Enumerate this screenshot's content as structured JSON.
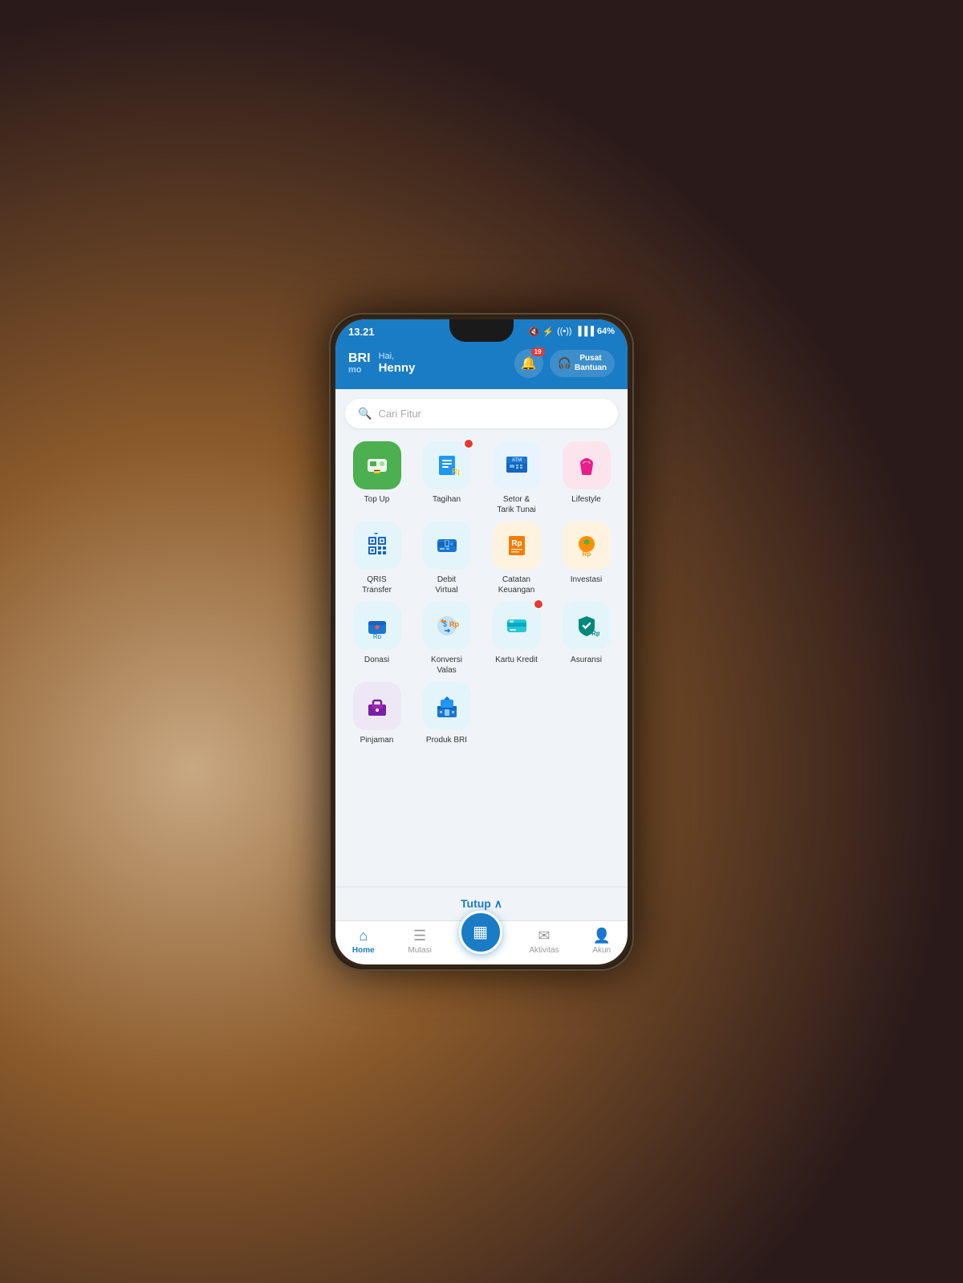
{
  "background": "#2a1a1a",
  "status_bar": {
    "time": "13.21",
    "icons": [
      "♥",
      "◎",
      "▶",
      "•"
    ],
    "right_icons": [
      "🔇",
      "⚡",
      "((•))",
      "▐▐▐▐"
    ],
    "battery": "64%"
  },
  "header": {
    "brand_top": "BRI",
    "brand_bottom": "mo",
    "greeting_pre": "Hai,",
    "greeting_name": "Henny",
    "notification_count": "19",
    "help_label": "Pusat\nBantuan"
  },
  "search": {
    "placeholder": "Cari Fitur"
  },
  "features": [
    {
      "id": "top-up",
      "label": "Top Up",
      "bg": "bg-green",
      "icon": "💳",
      "has_dot": false
    },
    {
      "id": "tagihan",
      "label": "Tagihan",
      "bg": "bg-lightblue",
      "icon": "🧾",
      "has_dot": true
    },
    {
      "id": "setor-tarik",
      "label": "Setor &\nTarik Tunai",
      "bg": "bg-atm",
      "icon": "🏧",
      "has_dot": false
    },
    {
      "id": "lifestyle",
      "label": "Lifestyle",
      "bg": "bg-pink-light",
      "icon": "👜",
      "has_dot": false
    },
    {
      "id": "qris-transfer",
      "label": "QRIS\nTransfer",
      "bg": "bg-qris",
      "icon": "⬛",
      "has_dot": false
    },
    {
      "id": "debit-virtual",
      "label": "Debit\nVirtual",
      "bg": "bg-debit",
      "icon": "💳",
      "has_dot": false
    },
    {
      "id": "catatan-keuangan",
      "label": "Catatan\nKeuangan",
      "bg": "bg-catatan",
      "icon": "📝",
      "has_dot": false
    },
    {
      "id": "investasi",
      "label": "Investasi",
      "bg": "bg-investasi",
      "icon": "🌱",
      "has_dot": false
    },
    {
      "id": "donasi",
      "label": "Donasi",
      "bg": "bg-donasi",
      "icon": "❤️",
      "has_dot": false
    },
    {
      "id": "konversi-valas",
      "label": "Konversi\nValas",
      "bg": "bg-konversi",
      "icon": "💱",
      "has_dot": false
    },
    {
      "id": "kartu-kredit",
      "label": "Kartu Kredit",
      "bg": "bg-kartu",
      "icon": "💳",
      "has_dot": true
    },
    {
      "id": "asuransi",
      "label": "Asuransi",
      "bg": "bg-asuransi",
      "icon": "🛡️",
      "has_dot": false
    },
    {
      "id": "pinjaman",
      "label": "Pinjaman",
      "bg": "bg-pinjaman",
      "icon": "💼",
      "has_dot": false
    },
    {
      "id": "produk-bri",
      "label": "Produk BRI",
      "bg": "bg-produk",
      "icon": "🏦",
      "has_dot": false
    }
  ],
  "tutup": {
    "label": "Tutup",
    "icon": "∧"
  },
  "bottom_nav": [
    {
      "id": "home",
      "label": "Home",
      "icon": "⌂",
      "active": true
    },
    {
      "id": "mutasi",
      "label": "Mutasi",
      "icon": "≡",
      "active": false
    },
    {
      "id": "qris",
      "label": "",
      "icon": "▦",
      "active": false,
      "is_center": true
    },
    {
      "id": "aktivitas",
      "label": "Aktivitas",
      "icon": "✉",
      "active": false
    },
    {
      "id": "akun",
      "label": "Akun",
      "icon": "👤",
      "active": false
    }
  ],
  "colors": {
    "brand_blue": "#1a7cc4",
    "red_dot": "#e53935",
    "text_dark": "#333333",
    "text_gray": "#999999"
  }
}
